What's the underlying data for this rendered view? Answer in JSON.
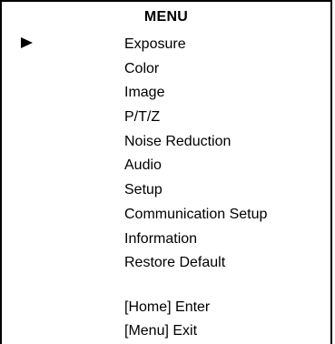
{
  "menu": {
    "title": "MENU",
    "selected_index": 0,
    "items": [
      {
        "label": "Exposure"
      },
      {
        "label": "Color"
      },
      {
        "label": "Image"
      },
      {
        "label": "P/T/Z"
      },
      {
        "label": "Noise Reduction"
      },
      {
        "label": "Audio"
      },
      {
        "label": "Setup"
      },
      {
        "label": "Communication Setup"
      },
      {
        "label": "Information"
      },
      {
        "label": "Restore Default"
      }
    ],
    "hints": {
      "enter": "[Home] Enter",
      "exit": "[Menu] Exit"
    },
    "cursor_icon": "right-triangle-pointer"
  }
}
